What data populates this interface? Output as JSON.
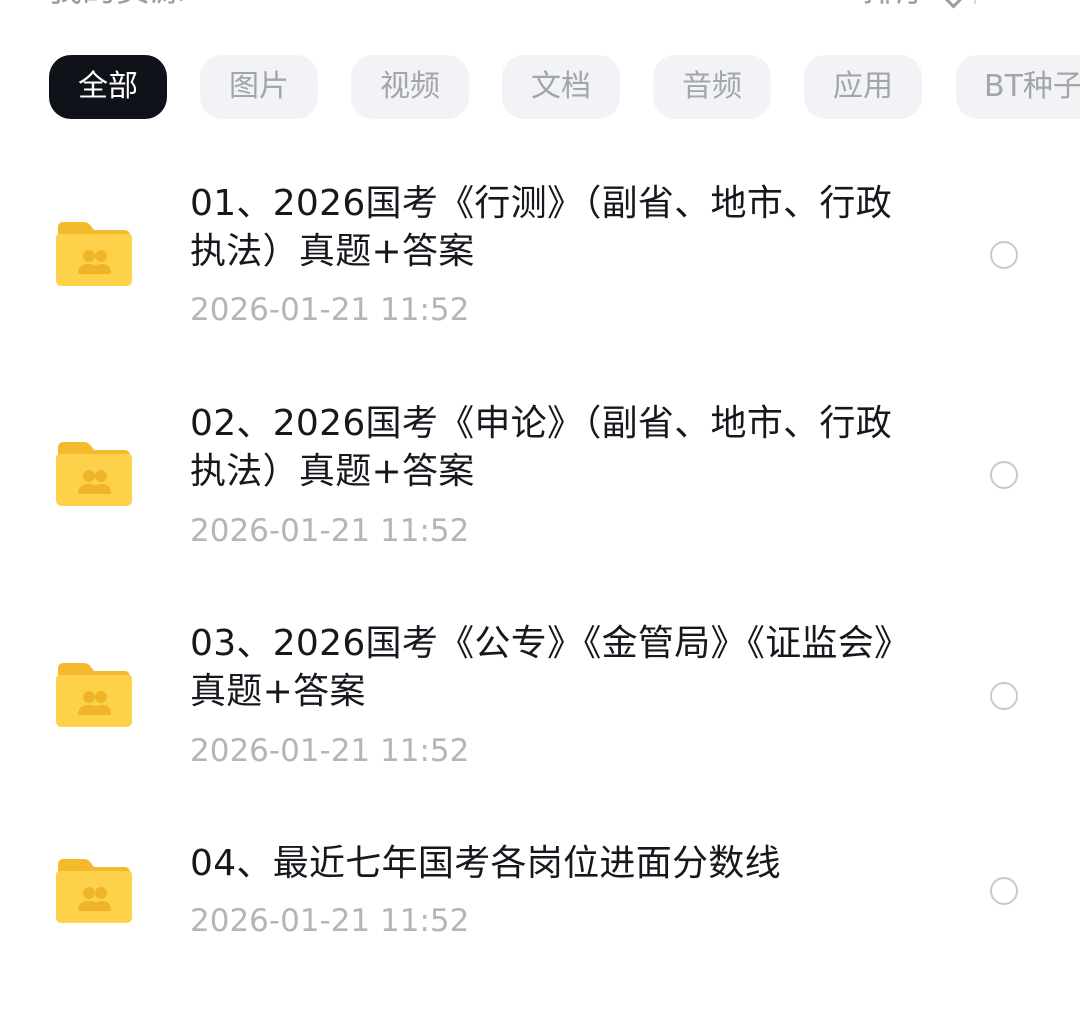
{
  "header": {
    "title": "我的资源",
    "sort_label": "排序"
  },
  "filters": [
    {
      "label": "全部",
      "active": true
    },
    {
      "label": "图片",
      "active": false
    },
    {
      "label": "视频",
      "active": false
    },
    {
      "label": "文档",
      "active": false
    },
    {
      "label": "音频",
      "active": false
    },
    {
      "label": "应用",
      "active": false
    },
    {
      "label": "BT种子",
      "active": false
    }
  ],
  "files": [
    {
      "name_lines": [
        "01、2026国考《行测》（副省、地市、行政",
        "执法）真题+答案"
      ],
      "date": "2026-01-21  11:52",
      "icon": "shared-folder-icon"
    },
    {
      "name_lines": [
        "02、2026国考《申论》（副省、地市、行政",
        "执法）真题+答案"
      ],
      "date": "2026-01-21  11:52",
      "icon": "shared-folder-icon"
    },
    {
      "name_lines": [
        "03、2026国考《公专》《金管局》《证监会》",
        "真题+答案"
      ],
      "date": "2026-01-21  11:52",
      "icon": "shared-folder-icon"
    },
    {
      "name_lines": [
        "04、最近七年国考各岗位进面分数线"
      ],
      "date": "2026-01-21  11:52",
      "icon": "shared-folder-icon"
    }
  ],
  "colors": {
    "active_chip_bg": "#0f1219",
    "chip_bg": "#f2f3f6",
    "folder_yellow": "#fdd24a",
    "date_gray": "#b3b5bb"
  }
}
